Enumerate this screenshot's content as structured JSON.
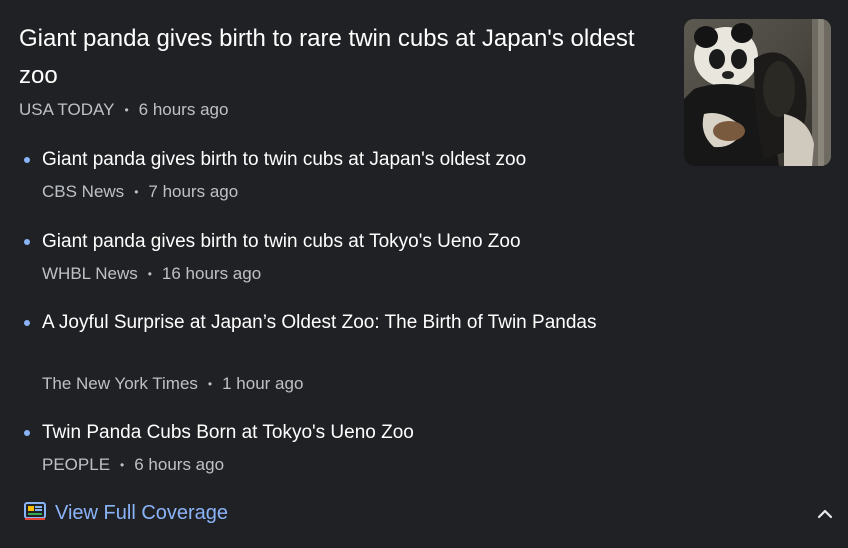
{
  "headline": {
    "title": "Giant panda gives birth to rare twin cubs at Japan's oldest zoo",
    "source": "USA TODAY",
    "time": "6 hours ago"
  },
  "thumbnail": {
    "icon": "panda-photo"
  },
  "stories": [
    {
      "title": "Giant panda gives birth to twin cubs at Japan's oldest zoo",
      "source": "CBS News",
      "time": "7 hours ago"
    },
    {
      "title": "Giant panda gives birth to twin cubs at Tokyo's Ueno Zoo",
      "source": "WHBL News",
      "time": "16 hours ago"
    },
    {
      "title": "A Joyful Surprise at Japan’s Oldest Zoo: The Birth of Twin Pandas",
      "source": "The New York Times",
      "time": "1 hour ago"
    },
    {
      "title": "Twin Panda Cubs Born at Tokyo's Ueno Zoo",
      "source": "PEOPLE",
      "time": "6 hours ago"
    }
  ],
  "footer": {
    "coverage_label": "View Full Coverage",
    "coverage_icon": "full-coverage-icon",
    "collapse_icon": "chevron-up-icon"
  },
  "colors": {
    "background": "#202124",
    "link_accent": "#8ab4f8",
    "meta_text": "#bdc1c6"
  }
}
